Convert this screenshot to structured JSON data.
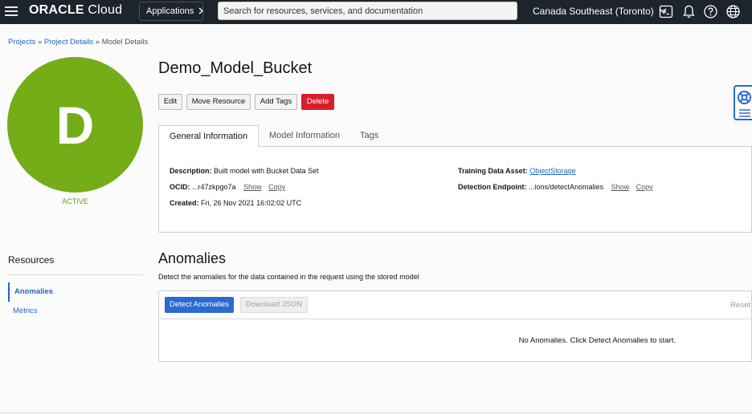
{
  "topbar": {
    "logo_bold": "ORACLE",
    "logo_light": " Cloud",
    "applications_label": "Applications",
    "search_placeholder": "Search for resources, services, and documentation",
    "region_label": "Canada Southeast (Toronto)",
    "icons": [
      "hamburger-menu-icon",
      "chevron-right-icon",
      "chevron-down-icon",
      "cloud-shell-icon",
      "bell-icon",
      "help-icon",
      "globe-icon"
    ],
    "background_color": "#1e242b"
  },
  "breadcrumb": {
    "items": [
      "Projects",
      "Project Details",
      "Model Details"
    ],
    "separator": " » "
  },
  "avatar": {
    "letter": "D",
    "color": "#74ad17",
    "status": "ACTIVE",
    "status_color": "#5c9c16"
  },
  "model": {
    "title": "Demo_Model_Bucket"
  },
  "actions": {
    "edit": "Edit",
    "move_resource": "Move Resource",
    "add_tags": "Add Tags",
    "delete": "Delete",
    "delete_color": "#d71f2b"
  },
  "tabs": [
    {
      "label": "General Information",
      "active": true
    },
    {
      "label": "Model Information",
      "active": false
    },
    {
      "label": "Tags",
      "active": false
    }
  ],
  "general_info": {
    "description_label": "Description:",
    "description_value": "Built model with Bucket Data Set",
    "ocid_label": "OCID:",
    "ocid_value": "...r47zkpgo7a",
    "created_label": "Created:",
    "created_value": "Fri, 26 Nov 2021 16:02:02 UTC",
    "training_label": "Training Data Asset:",
    "training_value": "ObjectStorage",
    "endpoint_label": "Detection Endpoint:",
    "endpoint_value": "...ions/detectAnomalies",
    "show_label": "Show",
    "copy_label": "Copy"
  },
  "resources": {
    "title": "Resources",
    "items": [
      {
        "label": "Anomalies",
        "active": true
      },
      {
        "label": "Metrics",
        "active": false
      }
    ]
  },
  "anomalies": {
    "title": "Anomalies",
    "description": "Detect the anomalies for the data contained in the request using the stored model",
    "detect_button": "Detect Anomalies",
    "download_button": "Download JSON",
    "reset_label": "Reset",
    "empty_message": "No Anomalies. Click Detect Anomalies to start.",
    "accent_color": "#2a6ad2"
  },
  "help_widget": {
    "icon": "lifebuoy-icon"
  }
}
